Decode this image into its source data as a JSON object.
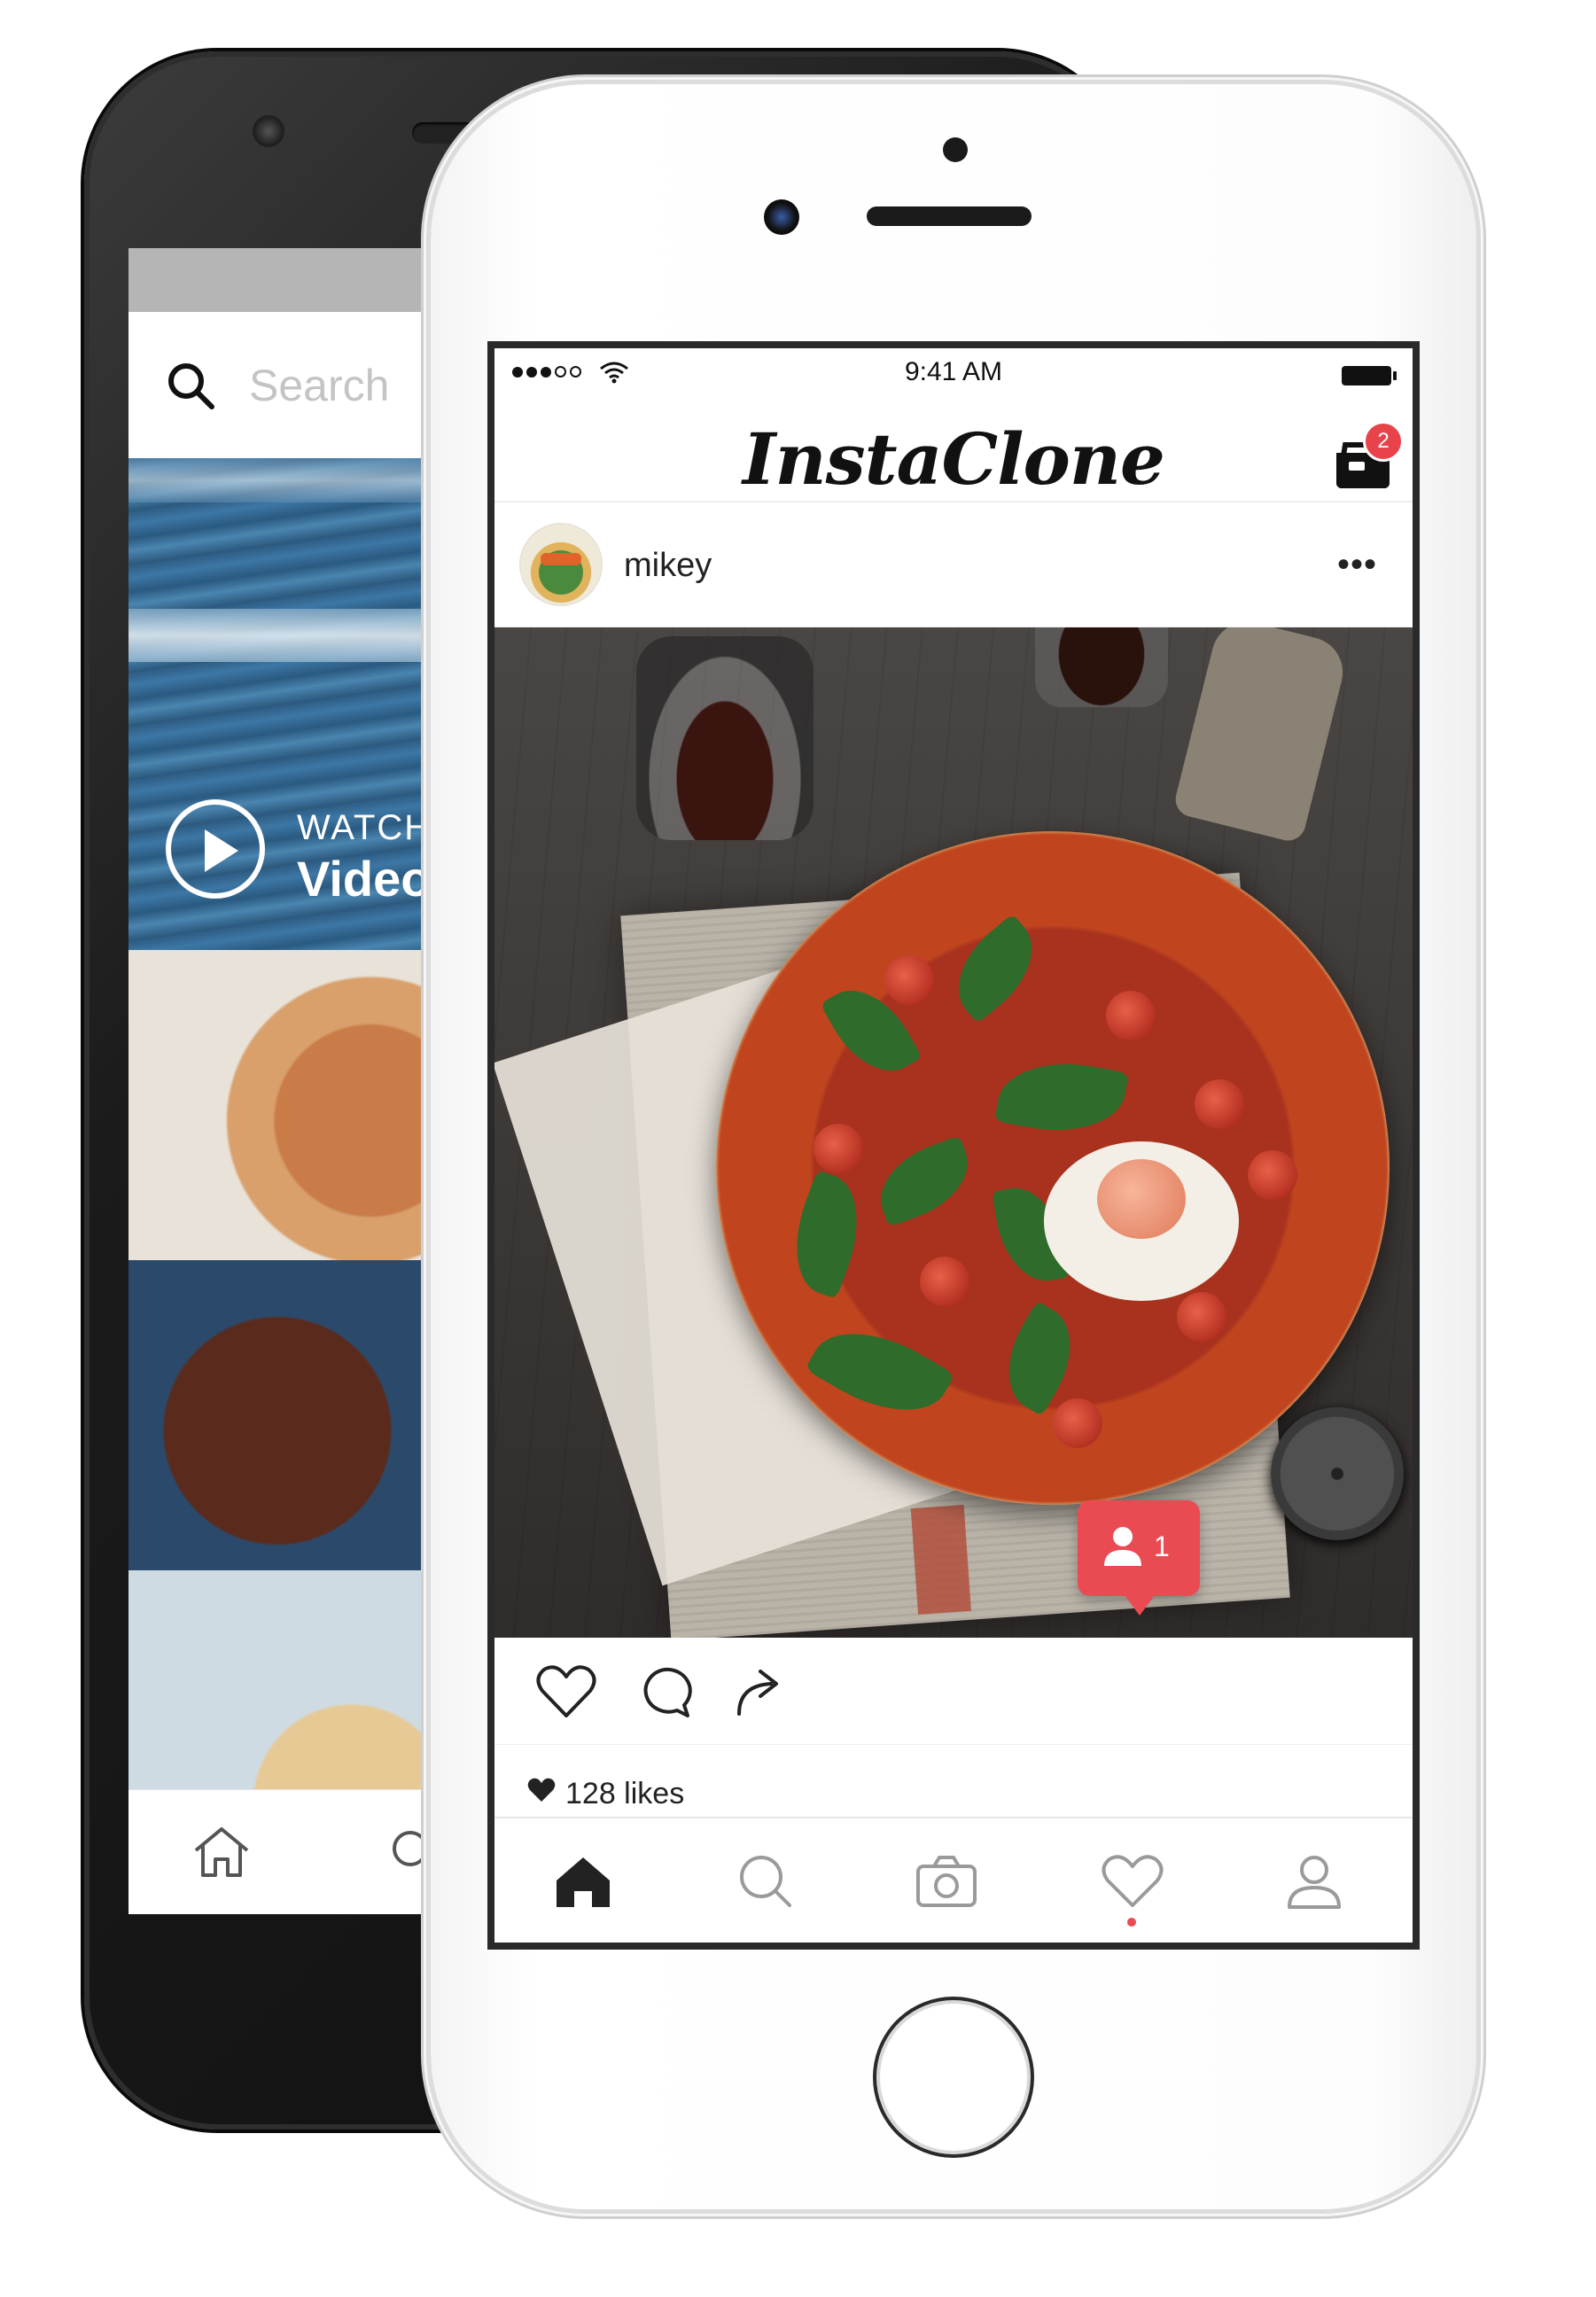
{
  "back_screen": {
    "search_placeholder": "Search",
    "video": {
      "watch_label": "WATCH",
      "video_label": "Video"
    }
  },
  "app": {
    "status": {
      "time": "9:41 AM"
    },
    "title": "InstaClone",
    "inbox_badge": "2",
    "post": {
      "username": "mikey",
      "more_icon": "•••",
      "likes": "128 likes"
    },
    "notification": {
      "count": "1"
    },
    "tabs": [
      "home-icon",
      "search-icon",
      "camera-icon",
      "heart-icon",
      "profile-icon"
    ]
  },
  "colors": {
    "accent": "#ea4b53",
    "text": "#222222"
  }
}
